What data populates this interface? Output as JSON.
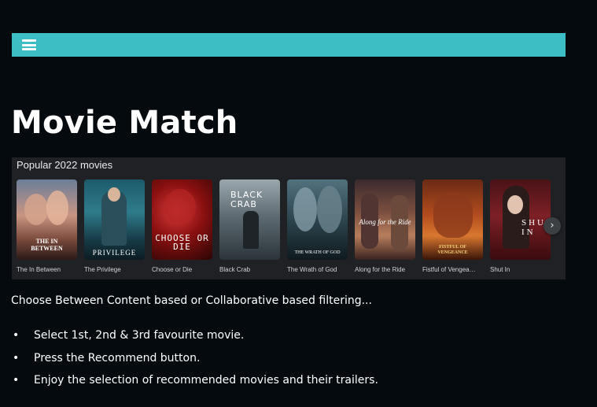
{
  "navbar": {
    "menu_icon": "hamburger-menu-icon",
    "background": "#3cbec4"
  },
  "page": {
    "title": "Movie Match"
  },
  "carousel": {
    "heading": "Popular 2022 movies",
    "next_icon": "chevron-right-icon",
    "next_glyph": "›",
    "movies": [
      {
        "title": "The In Between",
        "poster_text": "THE IN BETWEEN"
      },
      {
        "title": "The Privilege",
        "poster_text": "PRIVILEGE"
      },
      {
        "title": "Choose or Die",
        "poster_text": "CHOOSE OR DIE"
      },
      {
        "title": "Black Crab",
        "poster_text": "BLACK CRAB"
      },
      {
        "title": "The Wrath of God",
        "poster_text": "THE WRATH OF GOD"
      },
      {
        "title": "Along for the Ride",
        "poster_text": "Along for the Ride"
      },
      {
        "title": "Fistful of Vengea…",
        "poster_text": "FISTFUL OF VENGEANCE"
      },
      {
        "title": "Shut In",
        "poster_text": "SHUT IN"
      }
    ]
  },
  "intro": "Choose Between Content based or Collaborative based filtering...",
  "steps": [
    "Select 1st, 2nd & 3rd favourite movie.",
    "Press the Recommend button.",
    "Enjoy the selection of recommended movies and their trailers."
  ],
  "bullet": "•"
}
